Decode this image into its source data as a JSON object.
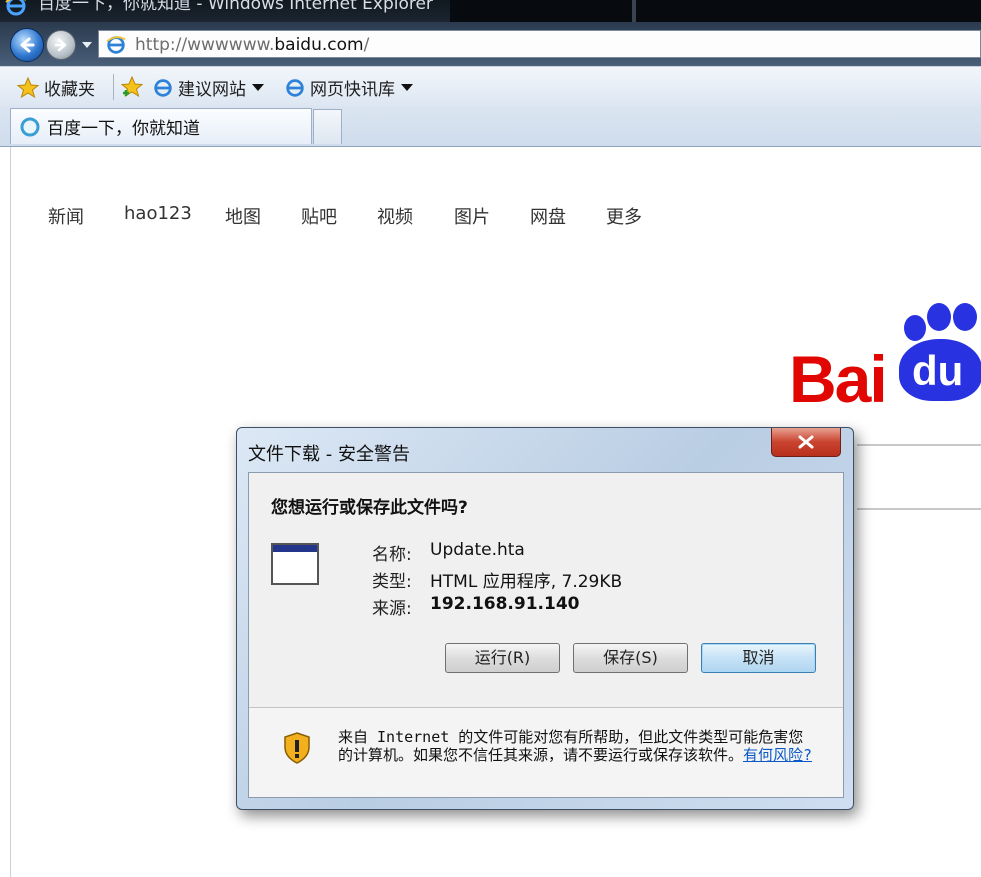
{
  "window": {
    "title": "百度一下，你就知道 - Windows Internet Explorer"
  },
  "address_bar": {
    "url_prefix": "http://wwwwww.",
    "url_domain": "baidu.com",
    "url_suffix": "/"
  },
  "favorites_bar": {
    "favorites_label": "收藏夹",
    "items": [
      {
        "label": "建议网站"
      },
      {
        "label": "网页快讯库"
      }
    ]
  },
  "tab": {
    "active_title": "百度一下，你就知道"
  },
  "page": {
    "nav_links": [
      "新闻",
      "hao123",
      "地图",
      "贴吧",
      "视频",
      "图片",
      "网盘",
      "更多"
    ],
    "logo_text": "Bai",
    "logo_text_paw": "du",
    "brand_colors": {
      "red": "#e10602",
      "blue": "#2932e1"
    }
  },
  "dialog": {
    "title": "文件下载 - 安全警告",
    "question": "您想运行或保存此文件吗?",
    "name_label": "名称:",
    "name_value": "Update.hta",
    "type_label": "类型:",
    "type_value": "HTML 应用程序, 7.29KB",
    "source_label": "来源:",
    "source_value": "192.168.91.140",
    "buttons": {
      "run": "运行(R)",
      "save": "保存(S)",
      "cancel": "取消"
    },
    "warning_text": "来自 Internet 的文件可能对您有所帮助，但此文件类型可能危害您的计算机。如果您不信任其来源，请不要运行或保存该软件。",
    "warning_link": "有何风险?"
  }
}
